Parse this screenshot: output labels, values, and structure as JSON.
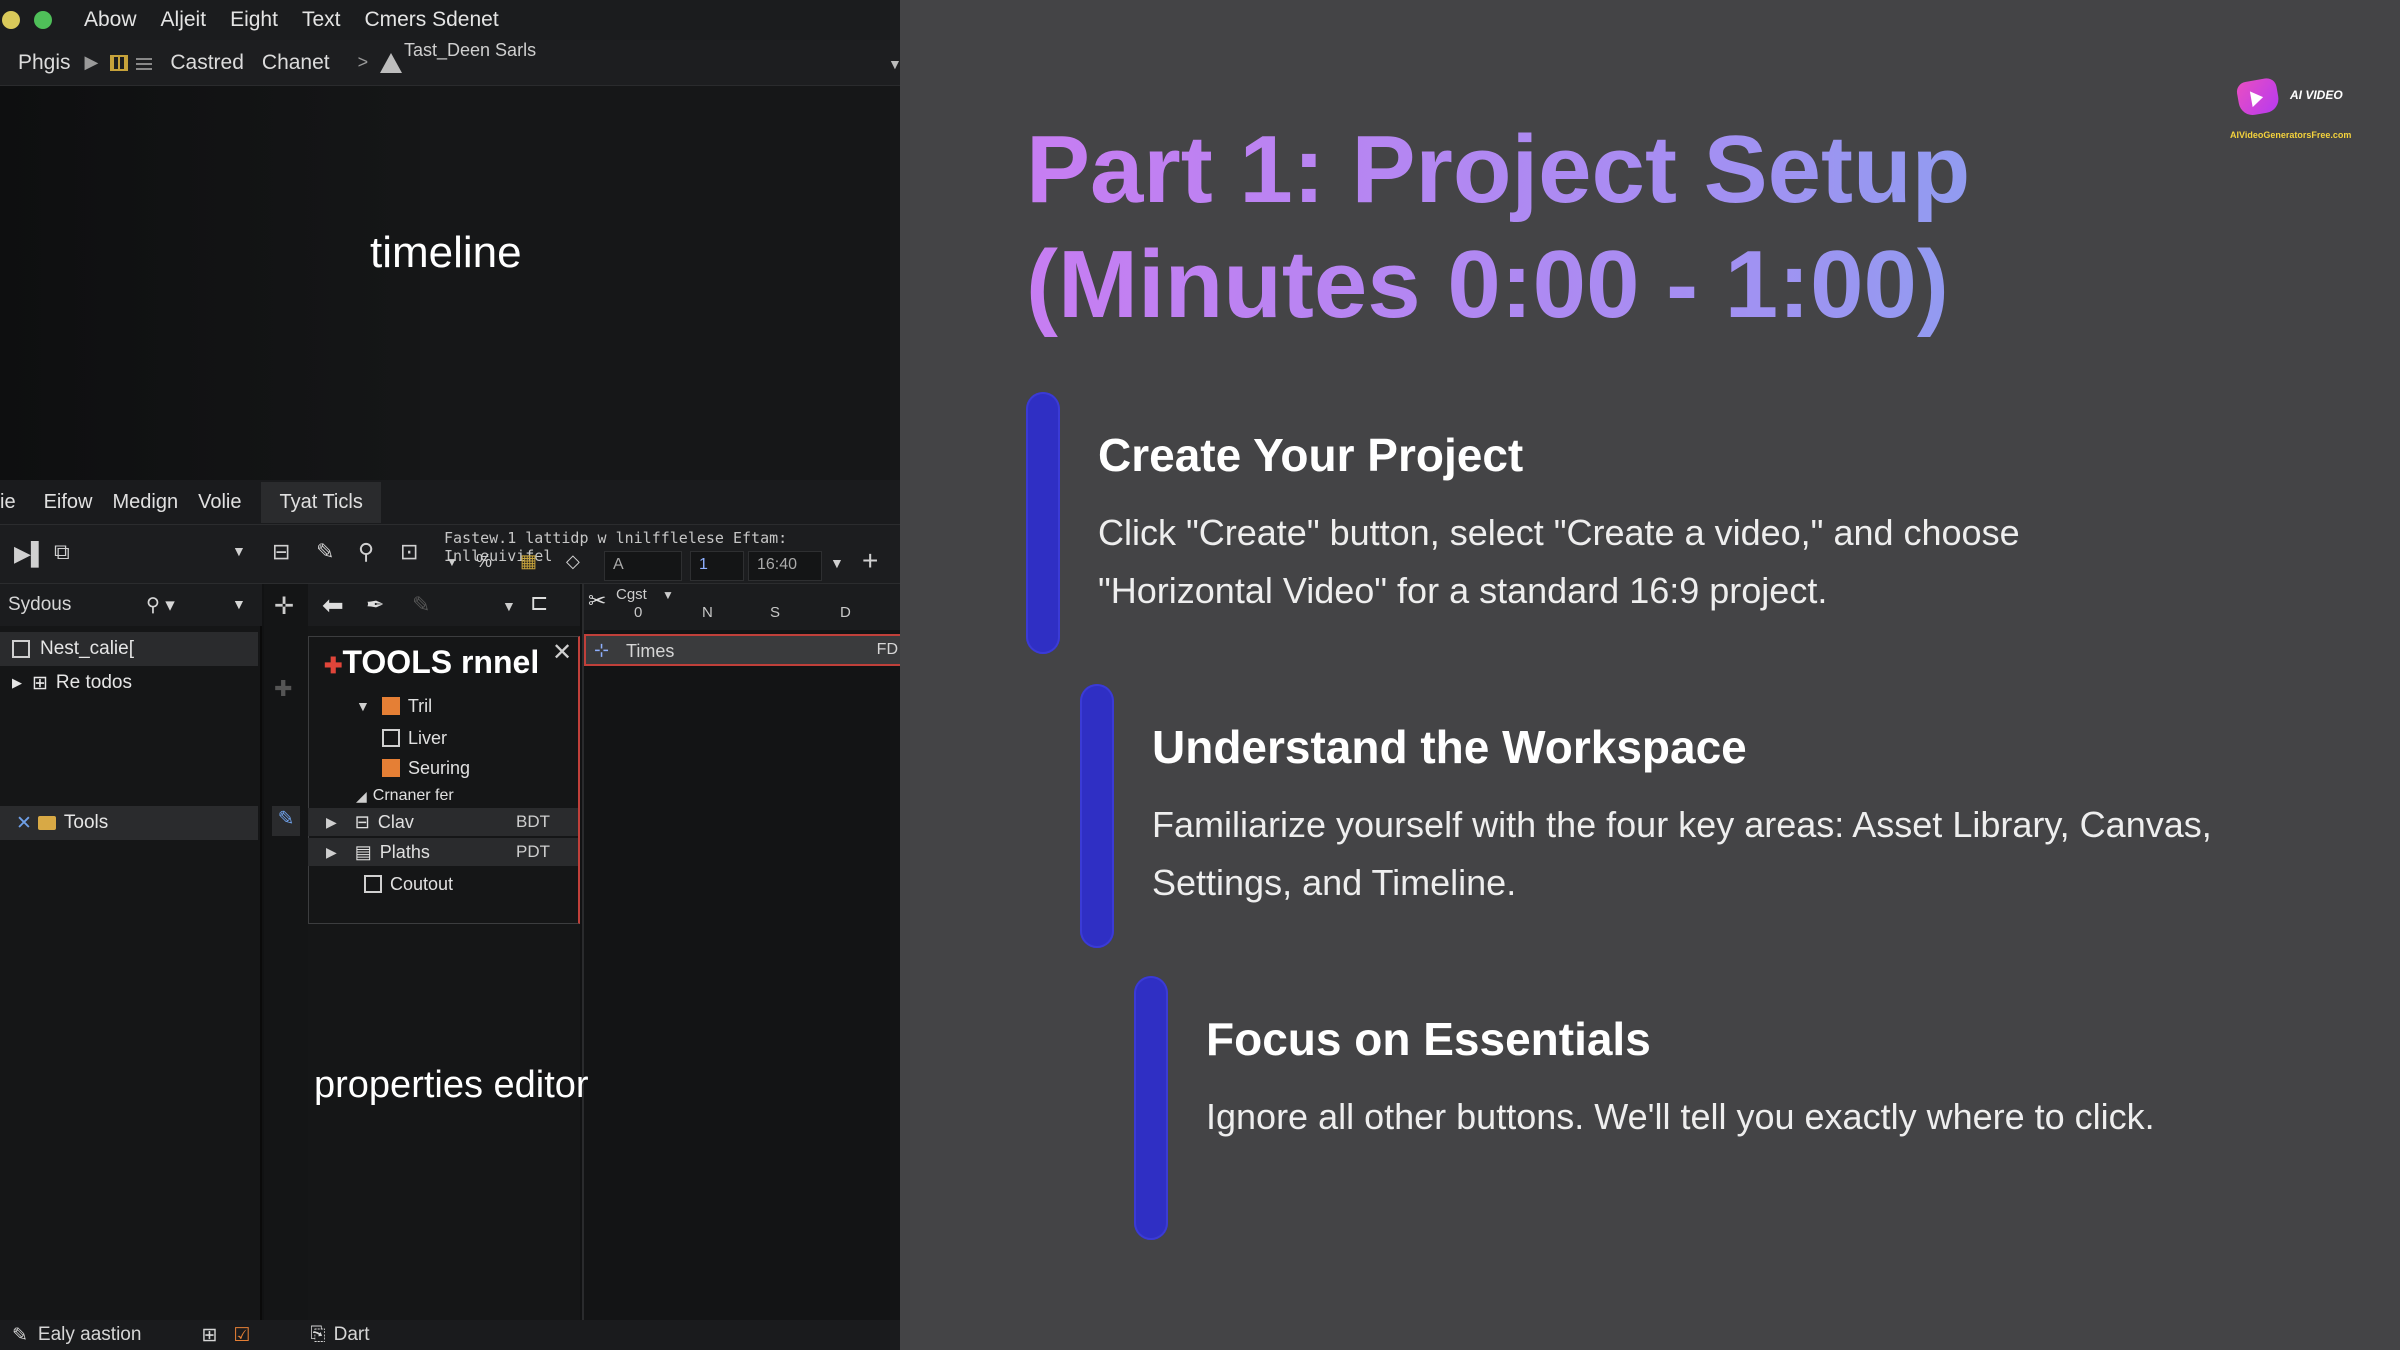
{
  "app": {
    "menu": [
      "Abow",
      "Aljeit",
      "Eight",
      "Text",
      "Cmers Sdenet"
    ],
    "path": {
      "item1": "Phgis",
      "item2": "Castred",
      "item3": "Chanet",
      "file": "Tast_Deen Sarls"
    },
    "viewport_label": "timeline",
    "tabs": [
      "ie",
      "Eifow",
      "Medign",
      "Volie",
      "Tyat Ticls"
    ],
    "toolbar_hint": "Fastew.1 lattidp w lnilfflelese Eftam: Inlleuivifel",
    "toolbar_field_a": "A",
    "toolbar_time": "16:40",
    "left_panel": {
      "header": "Sydous",
      "items": [
        "Nest_calie[",
        "Re todos",
        "Tools"
      ]
    },
    "tools_panel": {
      "title": "TOOLS rnnel",
      "items": [
        {
          "label": "Tril"
        },
        {
          "label": "Liver"
        },
        {
          "label": "Seuring"
        },
        {
          "label": "Crnaner fer"
        },
        {
          "label": "Clav",
          "badge": "BDT"
        },
        {
          "label": "Plaths",
          "badge": "PDT"
        },
        {
          "label": "Coutout"
        }
      ]
    },
    "timeline_panel": {
      "header": "Cgst",
      "ruler": [
        "0",
        "N",
        "S",
        "D"
      ],
      "track": "Times",
      "track_badge": "FD"
    },
    "properties_label": "properties editor",
    "status": {
      "left": "Ealy aastion",
      "right": "Dart"
    }
  },
  "slide": {
    "title_line1": "Part 1: Project Setup",
    "title_line2": "(Minutes 0:00 - 1:00)",
    "logo_brand": "AI VIDEO",
    "logo_site": "AIVideoGeneratorsFree.com",
    "steps": [
      {
        "heading": "Create Your Project",
        "body": "Click \"Create\" button, select \"Create a video,\" and choose \"Horizontal Video\" for a standard 16:9 project."
      },
      {
        "heading": "Understand the Workspace",
        "body": "Familiarize yourself with the four key areas: Asset Library, Canvas, Settings, and Timeline."
      },
      {
        "heading": "Focus on Essentials",
        "body": "Ignore all other buttons. We'll tell you exactly where to click."
      }
    ]
  },
  "colors": {
    "slide_bg": "#444446",
    "accent_bar": "#2f2fc4",
    "title_gradient_start": "#c77df2",
    "title_gradient_end": "#86a3f0"
  }
}
